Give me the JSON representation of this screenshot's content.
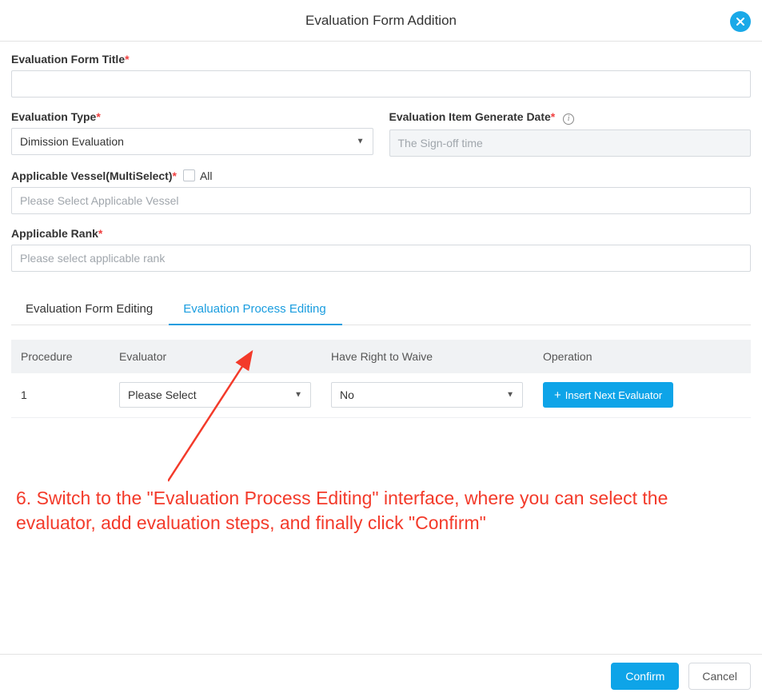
{
  "header": {
    "title": "Evaluation Form Addition"
  },
  "form": {
    "title_label": "Evaluation Form Title",
    "title_value": "",
    "type_label": "Evaluation Type",
    "type_value": "Dimission Evaluation",
    "gen_date_label": "Evaluation Item Generate Date",
    "gen_date_value": "The Sign-off time",
    "vessel_label": "Applicable Vessel(MultiSelect)",
    "vessel_all_label": "All",
    "vessel_placeholder": "Please Select Applicable Vessel",
    "rank_label": "Applicable Rank",
    "rank_placeholder": "Please select applicable rank"
  },
  "tabs": {
    "form_editing": "Evaluation Form Editing",
    "process_editing": "Evaluation Process Editing"
  },
  "table": {
    "head": {
      "procedure": "Procedure",
      "evaluator": "Evaluator",
      "waive": "Have Right to Waive",
      "operation": "Operation"
    },
    "rows": [
      {
        "procedure": "1",
        "evaluator": "Please Select",
        "waive": "No"
      }
    ],
    "insert_label": "Insert Next Evaluator"
  },
  "annotation": "6. Switch to the \"Evaluation Process Editing\" interface, where you can select the evaluator, add evaluation steps, and finally click \"Confirm\"",
  "footer": {
    "confirm": "Confirm",
    "cancel": "Cancel"
  }
}
